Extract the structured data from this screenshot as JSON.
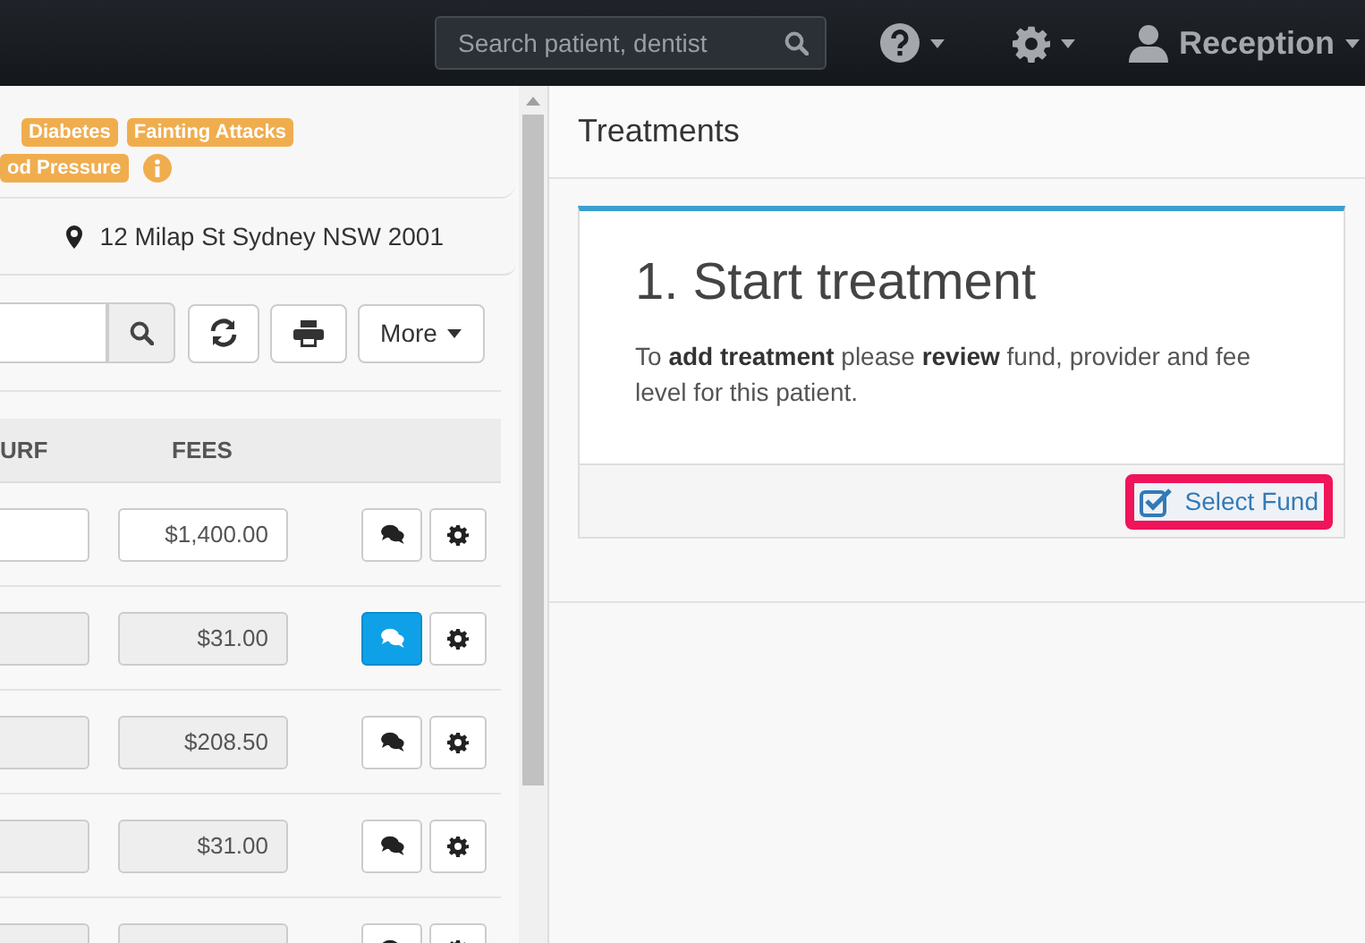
{
  "navbar": {
    "search": {
      "placeholder": "Search patient, dentist"
    },
    "user": "Reception"
  },
  "alerts": {
    "tags": [
      {
        "label": "Diabetes"
      },
      {
        "label": "Fainting Attacks"
      },
      {
        "label": "od Pressure"
      }
    ]
  },
  "address": "12 Milap St Sydney NSW 2001",
  "toolbar": {
    "more": "More"
  },
  "table": {
    "columns": [
      "URF",
      "FEES"
    ],
    "rows": [
      {
        "editable": true,
        "fee": "$1,400.00",
        "has_note": false
      },
      {
        "editable": false,
        "fee": "$31.00",
        "has_note": true
      },
      {
        "editable": false,
        "fee": "$208.50",
        "has_note": false
      },
      {
        "editable": false,
        "fee": "$31.00",
        "has_note": false
      },
      {
        "editable": false,
        "has_note": false
      }
    ]
  },
  "treatments": {
    "title": "Treatments",
    "card": {
      "heading": "1. Start treatment",
      "text": "To **add treatment** please **review** fund, provider and fee level for this patient.",
      "action": "Select Fund",
      "highlighted": true
    }
  }
}
